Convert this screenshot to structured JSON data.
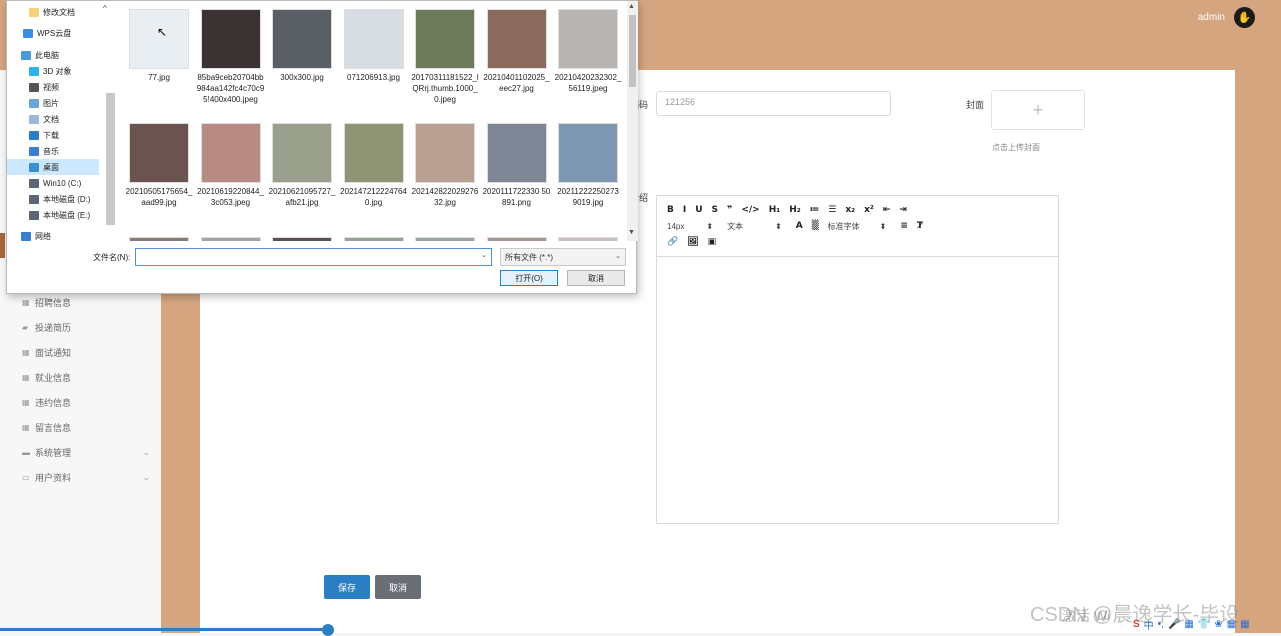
{
  "topbar": {
    "user": "admin",
    "avatar_icon": "✋"
  },
  "sidebar": {
    "items": [
      {
        "label": "招聘信息",
        "icon": "grid"
      },
      {
        "label": "投递简历",
        "icon": "briefcase"
      },
      {
        "label": "面试通知",
        "icon": "grid"
      },
      {
        "label": "就业信息",
        "icon": "grid"
      },
      {
        "label": "违约信息",
        "icon": "grid"
      },
      {
        "label": "留言信息",
        "icon": "grid"
      },
      {
        "label": "系统管理",
        "icon": "monitor",
        "chevron": "⌄"
      },
      {
        "label": "用户资料",
        "icon": "calendar",
        "chevron": "⌄"
      }
    ]
  },
  "form": {
    "code_label": "编码",
    "code_value": "121256",
    "cover_label": "封面",
    "cover_plus": "+",
    "cover_hint": "点击上传封面",
    "intro_label": "介绍",
    "save": "保存",
    "cancel": "取消"
  },
  "editor": {
    "row1": [
      "B",
      "I",
      "U",
      "S",
      "❞",
      "</>",
      "H₁",
      "H₂",
      "≔",
      "☰",
      "x₂",
      "x²",
      "⇤",
      "⇥"
    ],
    "font_size": "14px",
    "block": "文本",
    "font_family": "标准字体",
    "row3": [
      "🔗",
      "🖼",
      "▣"
    ]
  },
  "dialog": {
    "nav": [
      {
        "label": "修改文档",
        "color": "#f4d27a"
      },
      {
        "label": "WPS云盘",
        "color": "#3a8de0"
      },
      {
        "label": "此电脑",
        "color": "#4a9ad8"
      },
      {
        "label": "3D 对象",
        "color": "#2db3e6"
      },
      {
        "label": "视频",
        "color": "#555555"
      },
      {
        "label": "图片",
        "color": "#6aa6d8"
      },
      {
        "label": "文档",
        "color": "#9bb8d6"
      },
      {
        "label": "下载",
        "color": "#2c7ec4"
      },
      {
        "label": "音乐",
        "color": "#3a7fcf"
      },
      {
        "label": "桌面",
        "color": "#3b8fd9"
      },
      {
        "label": "Win10 (C:)",
        "color": "#5b6470"
      },
      {
        "label": "本地磁盘 (D:)",
        "color": "#5b6470"
      },
      {
        "label": "本地磁盘 (E:)",
        "color": "#5b6470"
      },
      {
        "label": "网络",
        "color": "#3a7fcf"
      }
    ],
    "files": [
      {
        "name": "77.jpg",
        "color": "#e9eef3"
      },
      {
        "name": "85ba9ceb20704bb984aa142fc4c70c95!400x400.jpeg",
        "color": "#3b3333"
      },
      {
        "name": "300x300.jpg",
        "color": "#5a5f66"
      },
      {
        "name": "071206913.jpg",
        "color": "#d8dde3"
      },
      {
        "name": "20170311181522_lQRrj.thumb.1000_0.jpeg",
        "color": "#6d7b5c"
      },
      {
        "name": "20210401102025_eec27.jpg",
        "color": "#8a6a5c"
      },
      {
        "name": "20210420232302_56119.jpeg",
        "color": "#b8b4b2"
      },
      {
        "name": "20210505175654_aad99.jpg",
        "color": "#6b5450"
      },
      {
        "name": "20210619220844_3c053.jpeg",
        "color": "#b88a84"
      },
      {
        "name": "20210621095727_afb21.jpg",
        "color": "#9aa08c"
      },
      {
        "name": "2021472122247640.jpg",
        "color": "#8f9474"
      },
      {
        "name": "20214282202927632.jpg",
        "color": "#b8a092"
      },
      {
        "name": "2020111722330 50891.png",
        "color": "#7f8796"
      },
      {
        "name": "20211222250273 9019.jpg",
        "color": "#7d97b0"
      },
      {
        "name": "",
        "color": "#8a7c74"
      },
      {
        "name": "",
        "color": "#a8a2a8"
      },
      {
        "name": "",
        "color": "#5c5250"
      },
      {
        "name": "",
        "color": "#98a294"
      },
      {
        "name": "",
        "color": "#9aa4a0"
      },
      {
        "name": "",
        "color": "#a69890"
      },
      {
        "name": "",
        "color": "#c8c0bc"
      }
    ],
    "filename_label": "文件名(N):",
    "filename_value": "",
    "filetype": "所有文件 (*.*)",
    "open": "打开(O)",
    "cancel": "取消"
  },
  "watermark": "CSDN @晨逸学长-毕设",
  "activate": "激活 Wi",
  "tray": [
    "中",
    "•,",
    "🎤",
    "▦",
    "👕",
    "❀",
    "▦",
    "▦"
  ]
}
